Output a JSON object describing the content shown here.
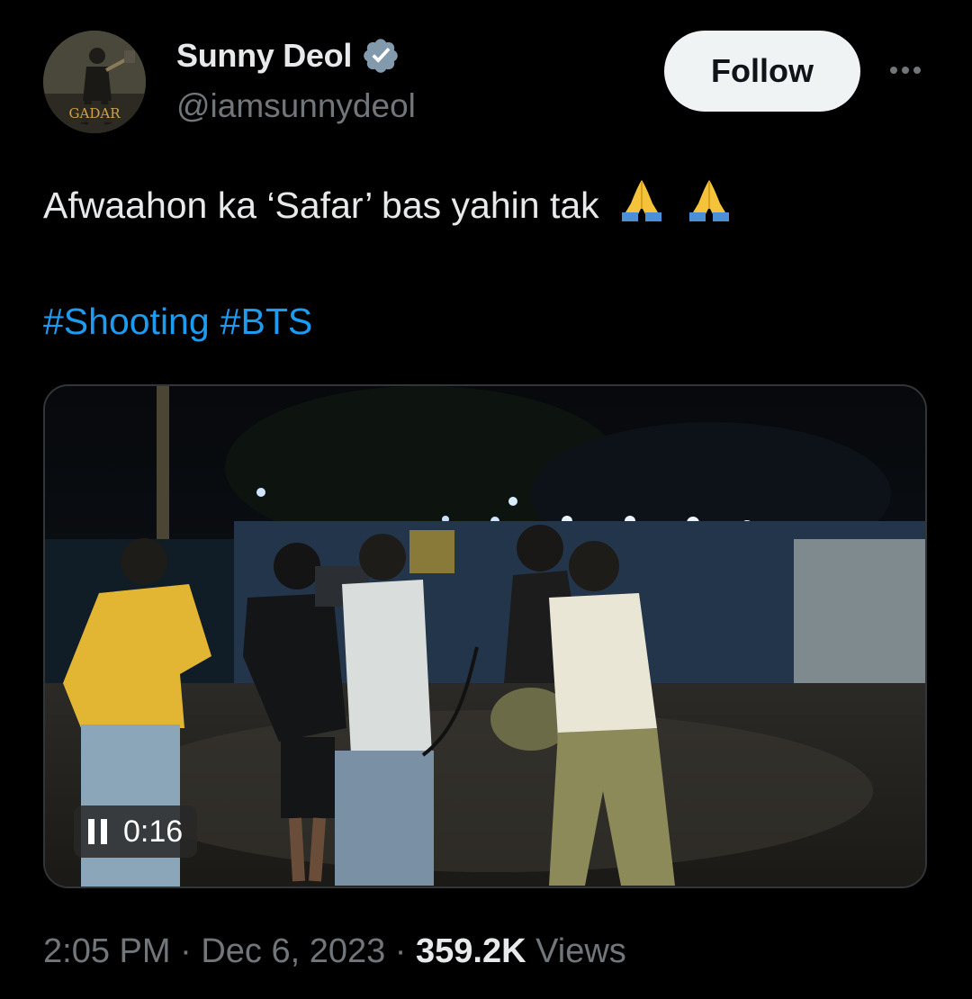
{
  "author": {
    "name": "Sunny Deol",
    "handle": "@iamsunnydeol",
    "avatar_badge_text": "GADAR",
    "verified": true
  },
  "actions": {
    "follow_label": "Follow",
    "more_icon": "more-horizontal-icon"
  },
  "tweet": {
    "text": "Afwaahon ka ‘Safar’ bas yahin tak",
    "emoji": [
      "folded-hands",
      "folded-hands"
    ],
    "hashtags": [
      "#Shooting",
      "#BTS"
    ]
  },
  "media": {
    "type": "video",
    "state_icon": "pause-icon",
    "elapsed": "0:16"
  },
  "meta": {
    "time": "2:05 PM",
    "separator": "·",
    "date": "Dec 6, 2023",
    "views_count": "359.2K",
    "views_label": "Views"
  },
  "colors": {
    "background": "#000000",
    "primary_text": "#e7e9ea",
    "secondary_text": "#71767b",
    "link": "#1d9bf0",
    "verified_badge": "#829aab"
  }
}
